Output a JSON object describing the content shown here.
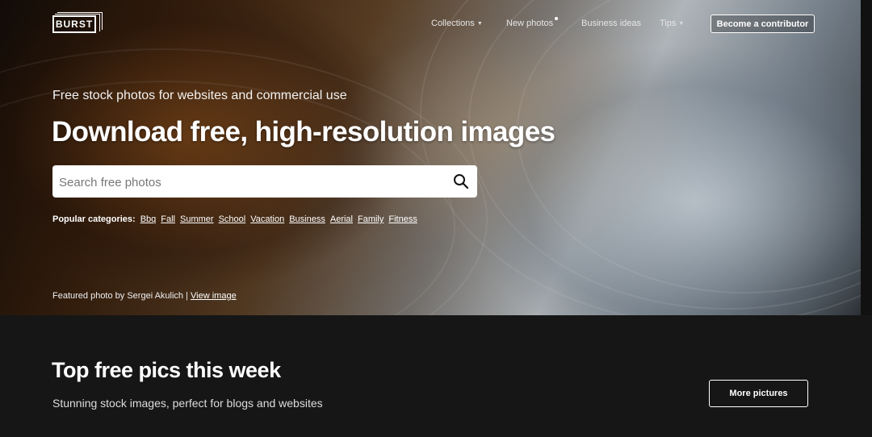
{
  "brand": {
    "logo_text": "BURST"
  },
  "nav": {
    "items": [
      {
        "label": "Collections",
        "has_dropdown": true
      },
      {
        "label": "New photos",
        "has_dot": true
      },
      {
        "label": "Business ideas"
      },
      {
        "label": "Tips",
        "has_dropdown": true
      }
    ],
    "contributor_button": "Become a contributor"
  },
  "hero": {
    "tagline": "Free stock photos for websites and commercial use",
    "headline": "Download free, high-resolution images",
    "search": {
      "placeholder": "Search free photos",
      "icon": "search-icon"
    },
    "categories": {
      "label": "Popular categories:",
      "items": [
        "Bbq",
        "Fall",
        "Summer",
        "School",
        "Vacation",
        "Business",
        "Aerial",
        "Family",
        "Fitness"
      ]
    },
    "credit": {
      "text": "Featured photo by Sergei Akulich |",
      "link": "View image"
    }
  },
  "section": {
    "title": "Top free pics this week",
    "subtitle": "Stunning stock images, perfect for blogs and websites",
    "button": "More pictures"
  },
  "colors": {
    "page_bg": "#161616",
    "text": "#ffffff",
    "search_bg": "#ffffff"
  }
}
